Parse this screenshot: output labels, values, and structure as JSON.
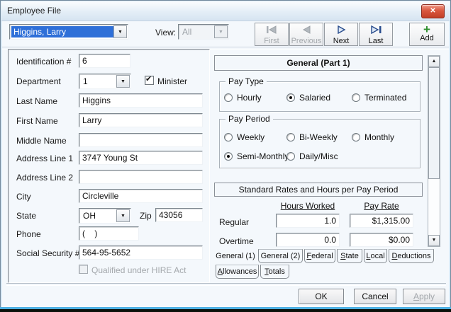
{
  "window": {
    "title": "Employee File"
  },
  "icons": {
    "close": "✕",
    "dropdown": "▼",
    "scroll_up": "▲",
    "scroll_down": "▼",
    "plus": "+",
    "check": "✔"
  },
  "toolbar": {
    "employee_combo": {
      "value": "Higgins, Larry"
    },
    "view": {
      "label": "View:",
      "value": "All"
    },
    "nav": [
      {
        "label": "First",
        "enabled": false
      },
      {
        "label": "Previous",
        "enabled": false
      },
      {
        "label": "Next",
        "enabled": true
      },
      {
        "label": "Last",
        "enabled": true
      }
    ],
    "add_label": "Add"
  },
  "form": {
    "fields": [
      {
        "label": "Identification #",
        "value": "6"
      },
      {
        "label": "Department",
        "value": "1"
      },
      {
        "label": "Last Name",
        "value": "Higgins"
      },
      {
        "label": "First Name",
        "value": "Larry"
      },
      {
        "label": "Middle Name",
        "value": ""
      },
      {
        "label": "Address Line 1",
        "value": "3747 Young St"
      },
      {
        "label": "Address Line 2",
        "value": ""
      },
      {
        "label": "City",
        "value": "Circleville"
      },
      {
        "label": "State",
        "value": "OH"
      },
      {
        "label": "Phone",
        "value": "(    )"
      },
      {
        "label": "Social Security #",
        "value": "564-95-5652"
      }
    ],
    "zip": {
      "label": "Zip",
      "value": "43056"
    },
    "minister": {
      "label": "Minister",
      "checked": true
    },
    "hire_act": {
      "label": "Qualified under HIRE Act",
      "checked": false,
      "enabled": false
    }
  },
  "panel": {
    "header": "General (Part 1)",
    "pay_type": {
      "legend": "Pay Type",
      "options": [
        {
          "label": "Hourly",
          "selected": false
        },
        {
          "label": "Salaried",
          "selected": true
        },
        {
          "label": "Terminated",
          "selected": false
        }
      ]
    },
    "pay_period": {
      "legend": "Pay Period",
      "options": [
        {
          "label": "Weekly",
          "selected": false
        },
        {
          "label": "Bi-Weekly",
          "selected": false
        },
        {
          "label": "Monthly",
          "selected": false
        },
        {
          "label": "Semi-Monthly",
          "selected": true
        },
        {
          "label": "Daily/Misc",
          "selected": false
        }
      ]
    },
    "rates": {
      "header": "Standard Rates and Hours per Pay Period",
      "columns": [
        "Hours Worked",
        "Pay Rate"
      ],
      "rows": [
        {
          "label": "Regular",
          "hours": "1.0",
          "rate": "$1,315.00"
        },
        {
          "label": "Overtime",
          "hours": "0.0",
          "rate": "$0.00"
        }
      ]
    },
    "tabs1": [
      {
        "label": "General (1)",
        "selected": true
      },
      {
        "label": "General (2)",
        "selected": false
      },
      {
        "key": "F",
        "post": "ederal"
      },
      {
        "key": "S",
        "post": "tate"
      },
      {
        "key": "L",
        "post": "ocal"
      },
      {
        "key": "D",
        "post": "eductions"
      }
    ],
    "tabs2": [
      {
        "key": "A",
        "post": "llowances"
      },
      {
        "key": "T",
        "post": "otals"
      }
    ]
  },
  "footer": {
    "ok": "OK",
    "cancel": "Cancel",
    "apply": {
      "key": "A",
      "post": "pply"
    }
  }
}
